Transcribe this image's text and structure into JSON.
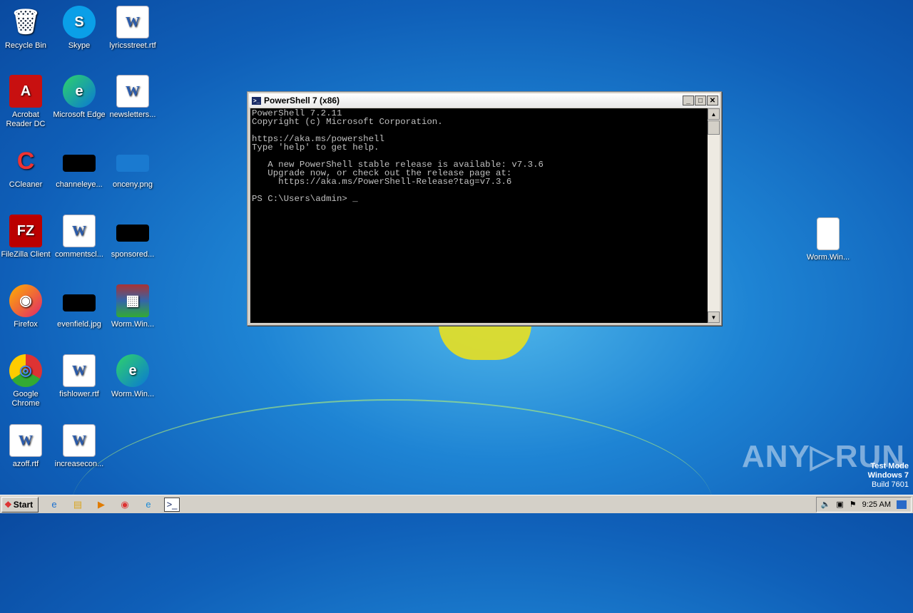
{
  "desktop_icons": [
    {
      "label": "Recycle Bin",
      "glyph": "🗑",
      "kind": "bin"
    },
    {
      "label": "Skype",
      "glyph": "S",
      "kind": "skype"
    },
    {
      "label": "lyricsstreet.rtf",
      "glyph": "W",
      "kind": "doc"
    },
    {
      "label": "Acrobat Reader DC",
      "glyph": "A",
      "kind": "acrobat"
    },
    {
      "label": "Microsoft Edge",
      "glyph": "e",
      "kind": "edge"
    },
    {
      "label": "newsletters...",
      "glyph": "W",
      "kind": "doc"
    },
    {
      "label": "CCleaner",
      "glyph": "C",
      "kind": "ccleaner"
    },
    {
      "label": "channeleye...",
      "glyph": "",
      "kind": "blk"
    },
    {
      "label": "onceny.png",
      "glyph": "",
      "kind": "blue"
    },
    {
      "label": "FileZilla Client",
      "glyph": "FZ",
      "kind": "filezilla"
    },
    {
      "label": "commentscl...",
      "glyph": "W",
      "kind": "doc"
    },
    {
      "label": "sponsored...",
      "glyph": "",
      "kind": "blk"
    },
    {
      "label": "Firefox",
      "glyph": "◉",
      "kind": "firefox"
    },
    {
      "label": "evenfield.jpg",
      "glyph": "",
      "kind": "blk"
    },
    {
      "label": "Worm.Win...",
      "glyph": "▦",
      "kind": "rar"
    },
    {
      "label": "Google Chrome",
      "glyph": "◎",
      "kind": "chrome"
    },
    {
      "label": "fishlower.rtf",
      "glyph": "W",
      "kind": "doc"
    },
    {
      "label": "Worm.Win...",
      "glyph": "e",
      "kind": "edge"
    },
    {
      "label": "azoff.rtf",
      "glyph": "W",
      "kind": "doc"
    },
    {
      "label": "increasecon...",
      "glyph": "W",
      "kind": "doc"
    }
  ],
  "right_icon": {
    "label": "Worm.Win...",
    "kind": "file"
  },
  "window": {
    "title": "PowerShell 7 (x86)",
    "console_lines": [
      "PowerShell 7.2.11",
      "Copyright (c) Microsoft Corporation.",
      "",
      "https://aka.ms/powershell",
      "Type 'help' to get help.",
      "",
      "   A new PowerShell stable release is available: v7.3.6",
      "   Upgrade now, or check out the release page at:",
      "     https://aka.ms/PowerShell-Release?tag=v7.3.6",
      "",
      "PS C:\\Users\\admin> _"
    ]
  },
  "taskbar": {
    "start_label": "Start",
    "apps": [
      "internet-explorer",
      "explorer",
      "media-player",
      "chrome",
      "edge",
      "powershell"
    ],
    "clock": "9:25 AM"
  },
  "watermark": {
    "line1": "Test Mode",
    "line2": "Windows 7",
    "line3": "Build 7601",
    "logo": "ANY RUN"
  }
}
